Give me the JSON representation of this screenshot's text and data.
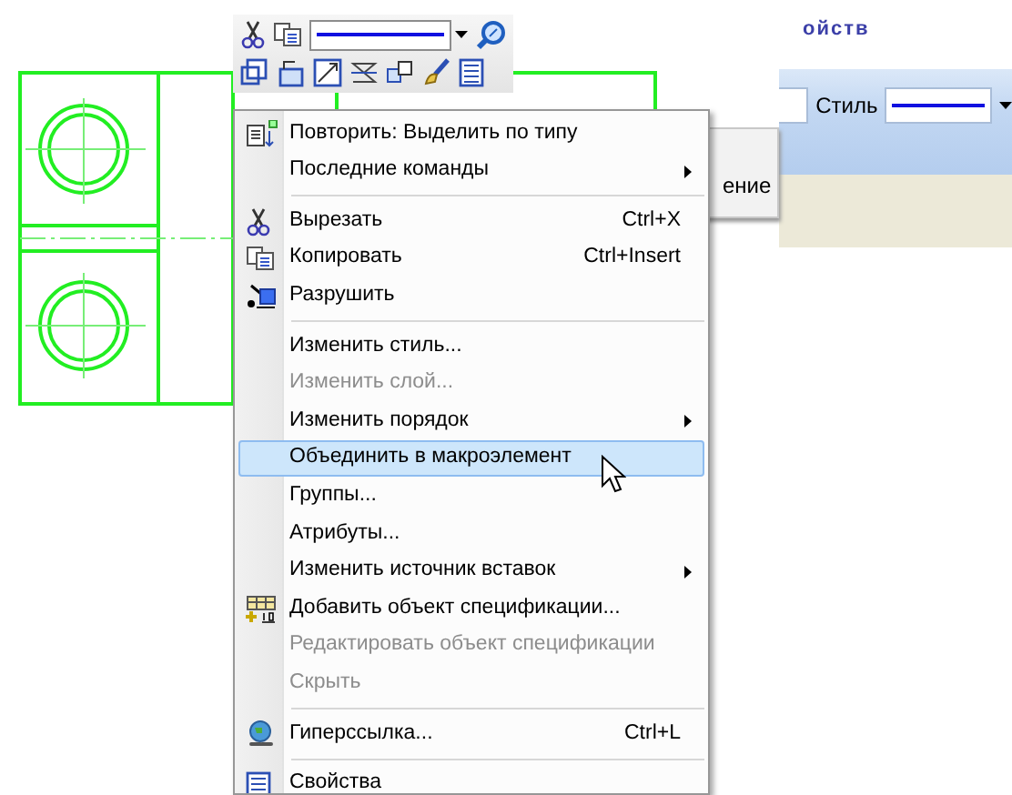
{
  "panel_title": "ойств",
  "style_toolbar": {
    "label": "Стиль"
  },
  "side_tab": {
    "label": "ение"
  },
  "context_menu": {
    "items": [
      {
        "kind": "item",
        "label": "Повторить: Выделить по типу",
        "submenu": false,
        "disabled": false,
        "selected": false
      },
      {
        "kind": "item",
        "label": "Последние команды",
        "submenu": true,
        "disabled": false,
        "selected": false
      },
      {
        "kind": "separator"
      },
      {
        "kind": "item",
        "label": "Вырезать",
        "shortcut": "Ctrl+X",
        "submenu": false,
        "disabled": false,
        "selected": false
      },
      {
        "kind": "item",
        "label": "Копировать",
        "shortcut": "Ctrl+Insert",
        "submenu": false,
        "disabled": false,
        "selected": false
      },
      {
        "kind": "item",
        "label": "Разрушить",
        "submenu": false,
        "disabled": false,
        "selected": false
      },
      {
        "kind": "separator"
      },
      {
        "kind": "item",
        "label": "Изменить стиль...",
        "submenu": false,
        "disabled": false,
        "selected": false
      },
      {
        "kind": "item",
        "label": "Изменить слой...",
        "submenu": false,
        "disabled": true,
        "selected": false
      },
      {
        "kind": "item",
        "label": "Изменить порядок",
        "submenu": true,
        "disabled": false,
        "selected": false
      },
      {
        "kind": "item",
        "label": "Объединить в макроэлемент",
        "submenu": false,
        "disabled": false,
        "selected": true
      },
      {
        "kind": "item",
        "label": "Группы...",
        "submenu": false,
        "disabled": false,
        "selected": false
      },
      {
        "kind": "item",
        "label": "Атрибуты...",
        "submenu": false,
        "disabled": false,
        "selected": false
      },
      {
        "kind": "item",
        "label": "Изменить источник вставок",
        "submenu": true,
        "disabled": false,
        "selected": false
      },
      {
        "kind": "item",
        "label": "Добавить объект спецификации...",
        "submenu": false,
        "disabled": false,
        "selected": false
      },
      {
        "kind": "item",
        "label": "Редактировать объект спецификации",
        "submenu": false,
        "disabled": true,
        "selected": false
      },
      {
        "kind": "item",
        "label": "Скрыть",
        "submenu": false,
        "disabled": true,
        "selected": false
      },
      {
        "kind": "separator"
      },
      {
        "kind": "item",
        "label": "Гиперссылка...",
        "shortcut": "Ctrl+L",
        "submenu": false,
        "disabled": false,
        "selected": false
      },
      {
        "kind": "separator"
      },
      {
        "kind": "item",
        "label": "Свойства",
        "submenu": false,
        "disabled": false,
        "selected": false
      }
    ]
  }
}
